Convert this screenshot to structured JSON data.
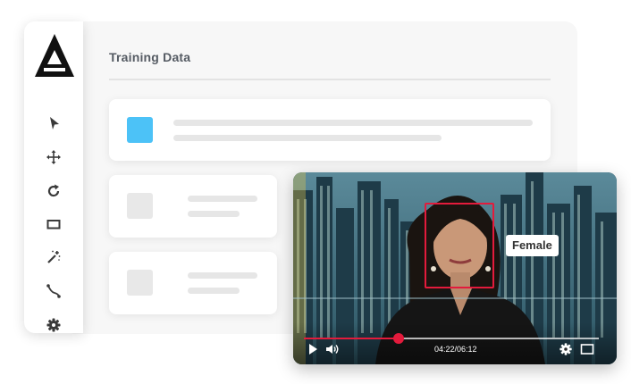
{
  "panel": {
    "title": "Training Data"
  },
  "toolbar": {
    "logo": "triangle-logo",
    "tools": [
      {
        "name": "select-tool",
        "icon": "cursor-icon"
      },
      {
        "name": "move-tool",
        "icon": "move-arrows-icon"
      },
      {
        "name": "rotate-tool",
        "icon": "rotate-icon"
      },
      {
        "name": "rectangle-tool",
        "icon": "rectangle-icon"
      },
      {
        "name": "magic-wand-tool",
        "icon": "magic-wand-icon"
      },
      {
        "name": "polyline-tool",
        "icon": "polyline-icon"
      },
      {
        "name": "settings-tool",
        "icon": "gear-icon"
      }
    ]
  },
  "cards": {
    "accent_color": "#4cc2f7"
  },
  "video": {
    "annotation_label": "Female",
    "box_color": "#e31b3c",
    "time_display": "04:22/06:12",
    "progress": 0.32
  }
}
